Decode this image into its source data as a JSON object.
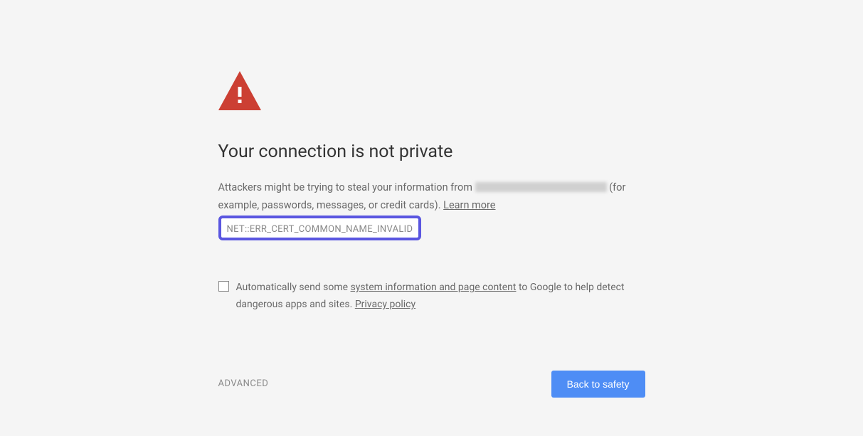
{
  "heading": "Your connection is not private",
  "body": {
    "prefix": "Attackers might be trying to steal your information from ",
    "suffix": " (for example, passwords, messages, or credit cards). ",
    "learn_more": "Learn more"
  },
  "error_code": "NET::ERR_CERT_COMMON_NAME_INVALID",
  "report": {
    "prefix": "Automatically send some ",
    "link1": "system information and page content",
    "mid": " to Google to help detect dangerous apps and sites. ",
    "link2": "Privacy policy"
  },
  "actions": {
    "advanced": "ADVANCED",
    "back": "Back to safety"
  },
  "colors": {
    "warning_icon": "#cc3f33",
    "highlight_border": "#5a56e0",
    "primary_button": "#4e8df5"
  }
}
